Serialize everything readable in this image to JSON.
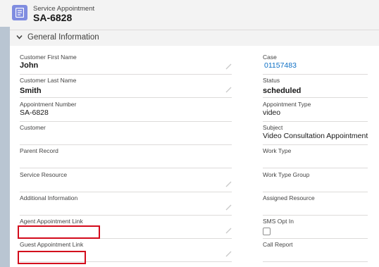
{
  "header": {
    "subtitle": "Service Appointment",
    "title": "SA-6828"
  },
  "section": {
    "title": "General Information"
  },
  "left_fields": [
    {
      "label": "Customer First Name",
      "value": "John"
    },
    {
      "label": "Customer Last Name",
      "value": "Smith"
    },
    {
      "label": "Appointment Number",
      "value": "SA-6828"
    },
    {
      "label": "Customer",
      "value": ""
    },
    {
      "label": "Parent Record",
      "value": ""
    },
    {
      "label": "Service Resource",
      "value": ""
    },
    {
      "label": "Additional Information",
      "value": ""
    },
    {
      "label": "Agent Appointment Link",
      "value": ""
    },
    {
      "label": "Guest Appointment Link",
      "value": ""
    }
  ],
  "right_fields": [
    {
      "label": "Case",
      "value": "01157483"
    },
    {
      "label": "Status",
      "value": "scheduled"
    },
    {
      "label": "Appointment Type",
      "value": "video"
    },
    {
      "label": "Subject",
      "value": "Video Consultation Appointment"
    },
    {
      "label": "Work Type",
      "value": ""
    },
    {
      "label": "Work Type Group",
      "value": ""
    },
    {
      "label": "Assigned Resource",
      "value": ""
    },
    {
      "label": "SMS Opt In",
      "value": ""
    },
    {
      "label": "Call Report",
      "value": ""
    }
  ],
  "colors": {
    "accent_icon": "#7f8ce0",
    "link": "#0b6ec5",
    "highlight_box": "#d30b1c"
  }
}
